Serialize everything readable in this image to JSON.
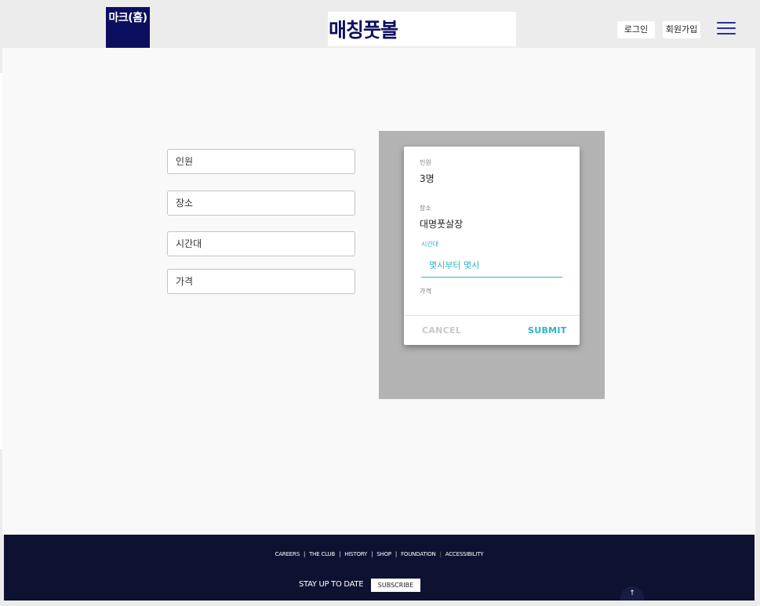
{
  "header": {
    "home_label": "마크(홈)",
    "site_title": "매칭풋볼",
    "login_label": "로그인",
    "signup_label": "회원가입",
    "menu_icon": "hamburger-icon"
  },
  "form": {
    "fields": [
      {
        "placeholder": "인원"
      },
      {
        "placeholder": "장소"
      },
      {
        "placeholder": "시간대"
      },
      {
        "placeholder": "가격"
      }
    ]
  },
  "dialog": {
    "count_label": "인원",
    "count_value": "3명",
    "place_label": "장소",
    "place_value": "대명풋살장",
    "time_label": "시간대",
    "time_placeholder": "몇시부터 몇시",
    "price_label": "가격",
    "cancel_label": "CANCEL",
    "submit_label": "SUBMIT"
  },
  "footer": {
    "links": [
      "CAREERS",
      "THE CLUB",
      "HISTORY",
      "SHOP",
      "FOUNDATION",
      "ACCESSIBILITY"
    ],
    "stay_label": "STAY UP TO DATE",
    "subscribe_label": "SUBSCRIBE",
    "to_top_icon": "arrow-up-icon"
  },
  "colors": {
    "brand_navy": "#0c0f5e",
    "accent_teal": "#2bb5c2",
    "footer_bg": "#0e1231",
    "overlay_gray": "#b3b3b3"
  }
}
